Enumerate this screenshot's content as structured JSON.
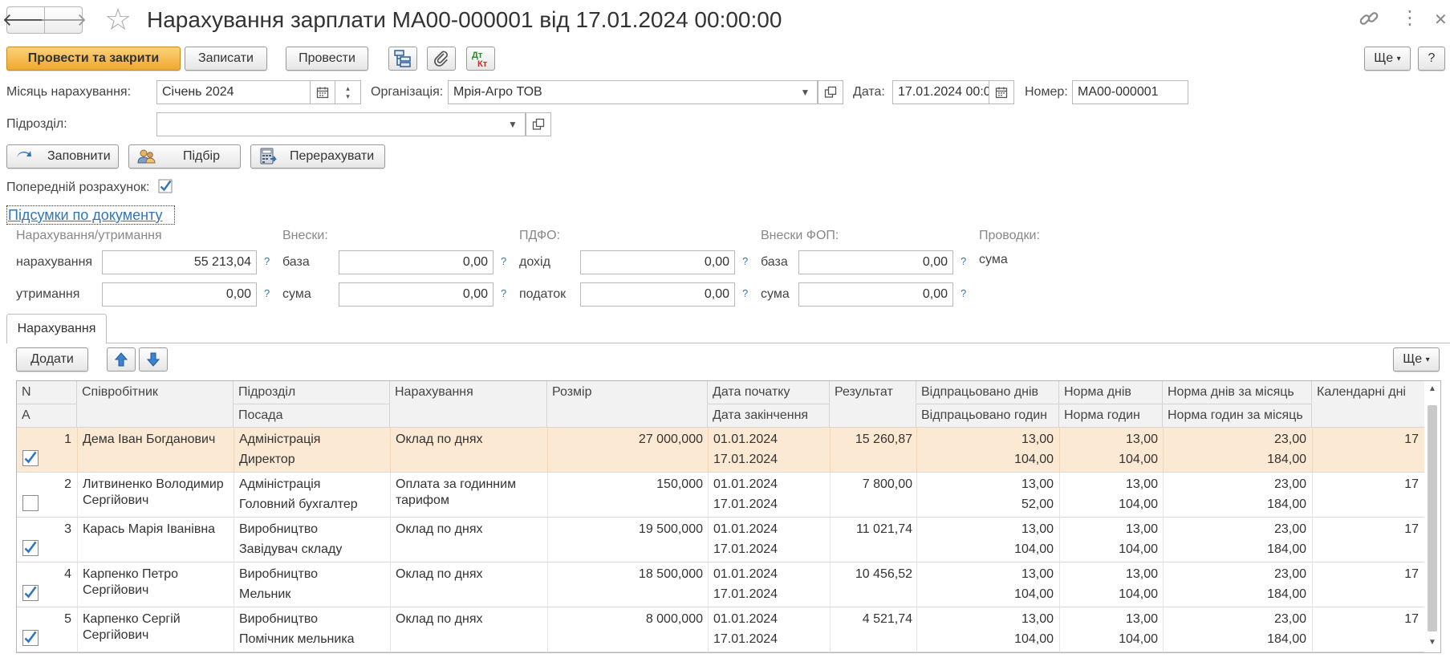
{
  "window": {
    "title": "Нарахування зарплати МА00-000001 від 17.01.2024 00:00:00"
  },
  "toolbar": {
    "post_and_close": "Провести та закрити",
    "save": "Записати",
    "post": "Провести",
    "more": "Ще",
    "help": "?"
  },
  "form": {
    "month_label": "Місяць нарахування:",
    "month_value": "Січень 2024",
    "org_label": "Організація:",
    "org_value": "Мрія-Агро ТОВ",
    "date_label": "Дата:",
    "date_value": "17.01.2024 00:0",
    "number_label": "Номер:",
    "number_value": "МА00-000001",
    "division_label": "Підрозділ:",
    "division_value": ""
  },
  "actions": {
    "fill": "Заповнити",
    "select": "Підбір",
    "recalc": "Перерахувати"
  },
  "preliminary": {
    "label": "Попередній розрахунок:",
    "checked": true
  },
  "summary": {
    "link": "Підсумки по документу",
    "accruals": {
      "title": "Нарахування/утримання",
      "accrual_label": "нарахування",
      "accrual_value": "55 213,04",
      "deduction_label": "утримання",
      "deduction_value": "0,00"
    },
    "contributions": {
      "title": "Внески:",
      "base_label": "база",
      "base_value": "0,00",
      "sum_label": "сума",
      "sum_value": "0,00"
    },
    "pdfo": {
      "title": "ПДФО:",
      "income_label": "дохід",
      "income_value": "0,00",
      "tax_label": "податок",
      "tax_value": "0,00"
    },
    "fop": {
      "title": "Внески ФОП:",
      "base_label": "база",
      "base_value": "0,00",
      "sum_label": "сума",
      "sum_value": "0,00"
    },
    "postings": {
      "title": "Проводки:",
      "sum_label": "сума"
    },
    "help": "?"
  },
  "tabs": {
    "accruals": "Нарахування"
  },
  "table_toolbar": {
    "add": "Додати",
    "more": "Ще"
  },
  "table": {
    "headers": {
      "n": "N",
      "a": "A",
      "employee": "Співробітник",
      "division": "Підрозділ",
      "position": "Посада",
      "accrual": "Нарахування",
      "amount": "Розмір",
      "date_start": "Дата початку",
      "date_end": "Дата закінчення",
      "result": "Результат",
      "worked_days": "Відпрацьовано днів",
      "worked_hours": "Відпрацьовано годин",
      "norm_days": "Норма днів",
      "norm_hours": "Норма годин",
      "norm_days_month": "Норма днів за місяць",
      "norm_hours_month": "Норма годин за місяць",
      "calendar_days": "Календарні дні"
    },
    "rows": [
      {
        "n": "1",
        "checked": true,
        "employee": "Дема Іван Богданович",
        "division": "Адміністрація",
        "position": "Директор",
        "accrual": "Оклад по днях",
        "amount": "27 000,000",
        "date_start": "01.01.2024",
        "date_end": "17.01.2024",
        "result": "15 260,87",
        "worked_days": "13,00",
        "worked_hours": "104,00",
        "norm_days": "13,00",
        "norm_hours": "104,00",
        "norm_days_month": "23,00",
        "norm_hours_month": "184,00",
        "calendar_days": "17"
      },
      {
        "n": "2",
        "checked": false,
        "employee": "Литвиненко Володимир Сергійович",
        "division": "Адміністрація",
        "position": "Головний бухгалтер",
        "accrual": "Оплата за годинним тарифом",
        "amount": "150,000",
        "date_start": "01.01.2024",
        "date_end": "17.01.2024",
        "result": "7 800,00",
        "worked_days": "13,00",
        "worked_hours": "52,00",
        "norm_days": "13,00",
        "norm_hours": "104,00",
        "norm_days_month": "23,00",
        "norm_hours_month": "184,00",
        "calendar_days": "17"
      },
      {
        "n": "3",
        "checked": true,
        "employee": "Карась Марія Іванівна",
        "division": "Виробництво",
        "position": "Завідувач складу",
        "accrual": "Оклад по днях",
        "amount": "19 500,000",
        "date_start": "01.01.2024",
        "date_end": "17.01.2024",
        "result": "11 021,74",
        "worked_days": "13,00",
        "worked_hours": "104,00",
        "norm_days": "13,00",
        "norm_hours": "104,00",
        "norm_days_month": "23,00",
        "norm_hours_month": "184,00",
        "calendar_days": "17"
      },
      {
        "n": "4",
        "checked": true,
        "employee": "Карпенко Петро Сергійович",
        "division": "Виробництво",
        "position": "Мельник",
        "accrual": "Оклад по днях",
        "amount": "18 500,000",
        "date_start": "01.01.2024",
        "date_end": "17.01.2024",
        "result": "10 456,52",
        "worked_days": "13,00",
        "worked_hours": "104,00",
        "norm_days": "13,00",
        "norm_hours": "104,00",
        "norm_days_month": "23,00",
        "norm_hours_month": "184,00",
        "calendar_days": "17"
      },
      {
        "n": "5",
        "checked": true,
        "employee": "Карпенко Сергій Сергійович",
        "division": "Виробництво",
        "position": "Помічник мельника",
        "accrual": "Оклад по днях",
        "amount": "8 000,000",
        "date_start": "01.01.2024",
        "date_end": "17.01.2024",
        "result": "4 521,74",
        "worked_days": "13,00",
        "worked_hours": "104,00",
        "norm_days": "13,00",
        "norm_hours": "104,00",
        "norm_days_month": "23,00",
        "norm_hours_month": "184,00",
        "calendar_days": "17"
      }
    ]
  }
}
